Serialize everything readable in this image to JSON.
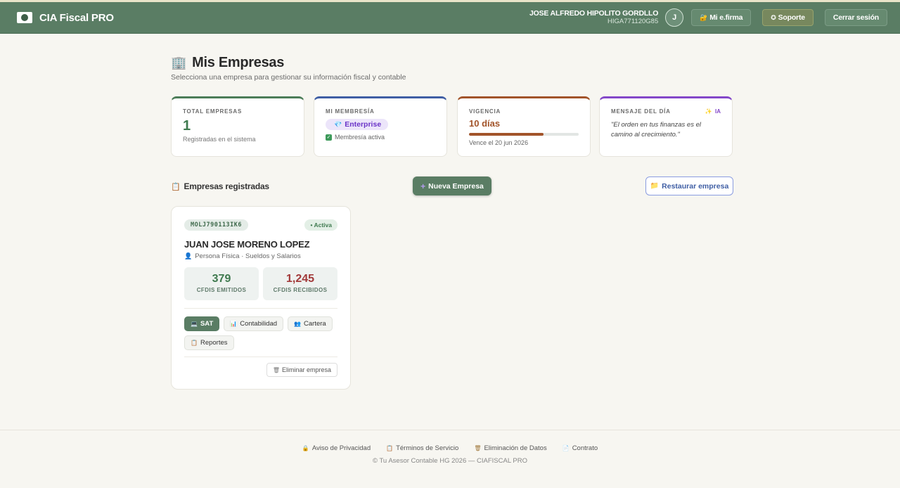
{
  "header": {
    "app_title": "CIA Fiscal PRO",
    "user_name": "JOSE ALFREDO HIPOLITO GORDLLO",
    "user_rfc": "HIGA771120G85",
    "avatar_initial": "J",
    "efirma_label": "Mi e.firma",
    "soporte_label": "Soporte",
    "logout_label": "Cerrar sesión"
  },
  "page": {
    "title": "Mis Empresas",
    "subtitle": "Selecciona una empresa para gestionar su información fiscal y contable"
  },
  "cards": {
    "total": {
      "label": "TOTAL EMPRESAS",
      "value": "1",
      "note": "Registradas en el sistema"
    },
    "membership": {
      "label": "MI MEMBRESÍA",
      "plan": "Enterprise",
      "status": "Membresía activa"
    },
    "vigencia": {
      "label": "VIGENCIA",
      "days": "10 días",
      "progress": 0.68,
      "expires": "Vence el 20 jun 2026"
    },
    "message": {
      "label": "MENSAJE DEL DÍA",
      "ia_label": "IA",
      "text": "\"El orden en tus finanzas es el camino al crecimiento.\""
    }
  },
  "section": {
    "title": "Empresas registradas",
    "new_label": "Nueva Empresa",
    "restore_label": "Restaurar empresa"
  },
  "company": {
    "rfc": "MOLJ790113IK6",
    "status": "• Activa",
    "name": "JUAN JOSE MORENO LOPEZ",
    "type": "Persona Física · Sueldos y Salarios",
    "emitidos": "379",
    "emitidos_label": "CFDIS EMITIDOS",
    "recibidos": "1,245",
    "recibidos_label": "CFDIS RECIBIDOS",
    "modules": [
      "SAT",
      "Contabilidad",
      "Cartera",
      "Reportes"
    ],
    "delete_label": "Eliminar empresa"
  },
  "footer": {
    "links": [
      "Aviso de Privacidad",
      "Términos de Servicio",
      "Eliminación de Datos",
      "Contrato"
    ],
    "copyright": "© Tu Asesor Contable HG 2026 — CIAFISCAL PRO"
  },
  "colors": {
    "header_bg": "#5a7d64",
    "accent_green": "#3f7a4f",
    "accent_blue": "#3f5ea4",
    "accent_orange": "#a2542a",
    "accent_purple": "#8448c9"
  }
}
